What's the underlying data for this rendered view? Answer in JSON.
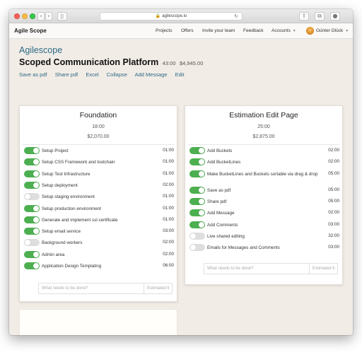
{
  "browser": {
    "url": "agilescope.io",
    "back_icon": "chevron-left-icon",
    "forward_icon": "chevron-right-icon",
    "reload_icon": "reload-icon"
  },
  "nav": {
    "brand": "Agile Scope",
    "links": [
      "Projects",
      "Offers",
      "Invite your team",
      "Feedback",
      "Accounts"
    ],
    "user": "Günter Glück"
  },
  "header": {
    "app_title": "Agilescope",
    "project_title": "Scoped Communication Platform",
    "project_hours": "43:00",
    "project_cost": "$4,945.00",
    "actions": [
      "Save as pdf",
      "Share pdf",
      "Excel",
      "Collapse",
      "Add Message",
      "Edit"
    ]
  },
  "colors": {
    "accent": "#2a6a85",
    "toggle_on": "#4caf50",
    "toggle_off": "#dedede",
    "background": "#f2ece6"
  },
  "cards": [
    {
      "title": "Foundation",
      "hours": "18:00",
      "cost": "$2,070.00",
      "placeholder": "What needs to be done?",
      "estimate_placeholder": "Estimated ti",
      "tasks": [
        {
          "label": "Setup Project",
          "hours": "01:00",
          "done": true
        },
        {
          "label": "Setup CSS Framework and toolchain",
          "hours": "01:00",
          "done": true
        },
        {
          "label": "Setup Test Infrastructure",
          "hours": "01:00",
          "done": true
        },
        {
          "label": "Setup deployment",
          "hours": "02:00",
          "done": true
        },
        {
          "label": "Setup staging environment",
          "hours": "01:00",
          "done": false
        },
        {
          "label": "Setup production environment",
          "hours": "01:00",
          "done": true
        },
        {
          "label": "Generate and implement ssl certificate",
          "hours": "01:00",
          "done": true
        },
        {
          "label": "Setup email service",
          "hours": "03:00",
          "done": true
        },
        {
          "label": "Background workers",
          "hours": "02:00",
          "done": false
        },
        {
          "label": "Admin area",
          "hours": "02:00",
          "done": true
        },
        {
          "label": "Application Design Templating",
          "hours": "06:00",
          "done": true
        }
      ]
    },
    {
      "title": "Estimation Edit Page",
      "hours": "25:00",
      "cost": "$2,875.00",
      "placeholder": "What needs to be done?",
      "estimate_placeholder": "Estimated ti",
      "tasks": [
        {
          "label": "Add Buckets",
          "hours": "02:00",
          "done": true
        },
        {
          "label": "Add BucketLines",
          "hours": "02:00",
          "done": true
        },
        {
          "label": "Make BucketLines and Buckets sortable via drag & drop",
          "hours": "05:00",
          "done": true
        },
        {
          "label": "Save as pdf",
          "hours": "05:00",
          "done": true
        },
        {
          "label": "Share pdf",
          "hours": "05:00",
          "done": true
        },
        {
          "label": "Add Message",
          "hours": "02:00",
          "done": true
        },
        {
          "label": "Add Comments",
          "hours": "03:00",
          "done": true
        },
        {
          "label": "Live shared editing",
          "hours": "32:00",
          "done": false
        },
        {
          "label": "Emails for Messages and Comments",
          "hours": "03:00",
          "done": false
        }
      ]
    }
  ]
}
